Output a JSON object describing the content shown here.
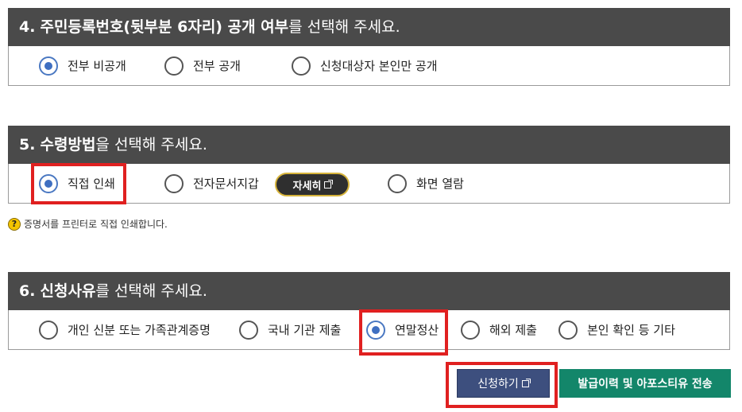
{
  "section4": {
    "number": "4.",
    "title_bold": "주민등록번호(뒷부분 6자리) 공개 여부",
    "title_rest": "를 선택해 주세요.",
    "options": [
      "전부 비공개",
      "전부 공개",
      "신청대상자 본인만 공개"
    ],
    "selected": 0
  },
  "section5": {
    "number": "5.",
    "title_bold": "수령방법",
    "title_rest": "을 선택해 주세요.",
    "options": [
      "직접 인쇄",
      "전자문서지갑",
      "화면 열람"
    ],
    "selected": 0,
    "detail_button": "자세히",
    "note": "증명서를 프린터로 직접 인쇄합니다.",
    "note_icon": "?"
  },
  "section6": {
    "number": "6.",
    "title_bold": "신청사유",
    "title_rest": "를 선택해 주세요.",
    "options": [
      "개인 신분 또는 가족관계증명",
      "국내 기관 제출",
      "연말정산",
      "해외 제출",
      "본인 확인 등 기타"
    ],
    "selected": 2
  },
  "buttons": {
    "apply": "신청하기",
    "history": "발급이력 및 아포스티유 전송"
  },
  "colors": {
    "header_bg": "#4a4a4a",
    "radio_selected": "#3f6fc1",
    "highlight": "#e02020",
    "apply_bg": "#3d4f7e",
    "history_bg": "#13866a"
  }
}
